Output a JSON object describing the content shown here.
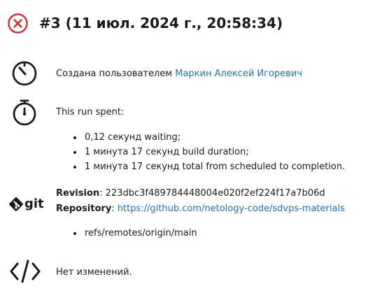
{
  "header": {
    "status": "failed",
    "title": "#3 (11 июл. 2024 г., 20:58:34)"
  },
  "created": {
    "prefix": "Создана пользователем",
    "user": "Маркин Алексей Игоревич"
  },
  "timing": {
    "heading": "This run spent:",
    "items": [
      "0,12 секунд waiting;",
      "1 минута 17 секунд build duration;",
      "1 минута 17 секунд total from scheduled to completion."
    ]
  },
  "git": {
    "logo_text": "git",
    "revision_label": "Revision",
    "revision_value": ": 223dbc3f489784448004e020f2ef224f17a7b06d",
    "repository_label": "Repository",
    "repository_sep": ": ",
    "repository_url": "https://github.com/netology-code/sdvps-materials",
    "refs": [
      "refs/remotes/origin/main"
    ]
  },
  "changes": {
    "text": "Нет изменений."
  },
  "colors": {
    "error_red": "#d9292f",
    "link_blue": "#1f6fc2",
    "text": "#1b1b1b"
  },
  "icons": {
    "status": "close-circle-icon",
    "created": "timer-icon",
    "timing": "stopwatch-icon",
    "git": "git-logo-icon",
    "changes": "code-icon"
  }
}
